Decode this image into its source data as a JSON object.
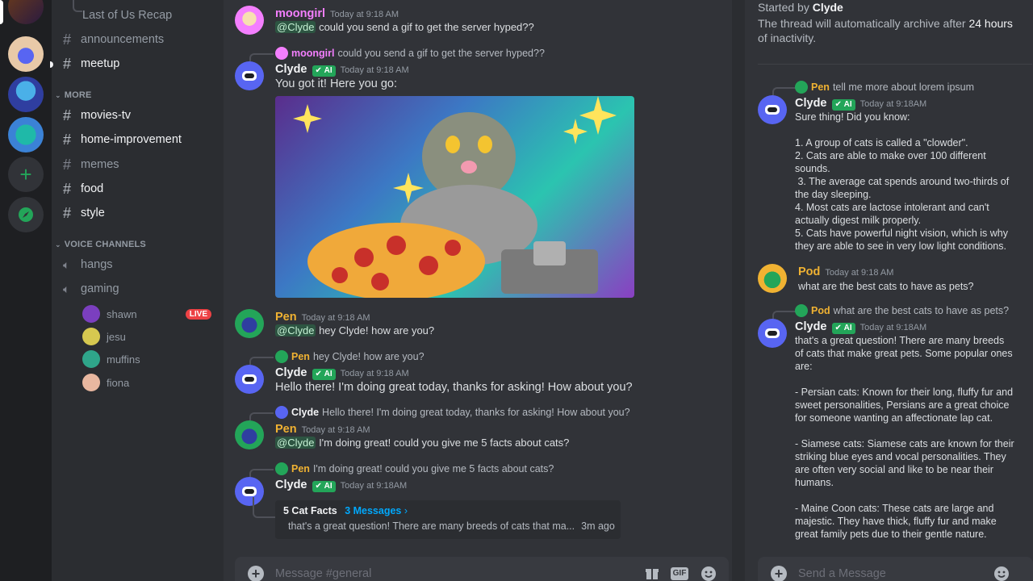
{
  "colors": {
    "accent_green": "#23a559",
    "pen_name": "#f0b232",
    "moongirl_name": "#f47fff",
    "clyde_name": "#f2f3f5",
    "link": "#00a8fc",
    "live": "#ed4245"
  },
  "rail": {
    "servers": [
      "server-icon-1",
      "server-icon-2",
      "server-icon-3",
      "server-icon-4"
    ],
    "add_server_icon": "plus-icon",
    "explore_icon": "compass-icon"
  },
  "sidebar": {
    "channels_top": [
      {
        "label": "Last of Us Recap"
      },
      {
        "label": "announcements"
      },
      {
        "label": "meetup"
      }
    ],
    "more_category": "MORE",
    "more_channels": [
      {
        "label": "movies-tv"
      },
      {
        "label": "home-improvement"
      },
      {
        "label": "memes"
      },
      {
        "label": "food"
      },
      {
        "label": "style"
      }
    ],
    "voice_category": "VOICE CHANNELS",
    "voice_channels": [
      {
        "label": "hangs"
      },
      {
        "label": "gaming"
      }
    ],
    "voice_users": [
      {
        "name": "shawn",
        "badge": "LIVE"
      },
      {
        "name": "jesu"
      },
      {
        "name": "muffins"
      },
      {
        "name": "fiona"
      }
    ]
  },
  "chat": {
    "messages": [
      {
        "user": "moongirl",
        "time": "Today at 9:18 AM",
        "mention": "@Clyde",
        "text": "could you send a gif to get the server hyped??"
      },
      {
        "reply_user": "moongirl",
        "reply_text": "could you send a gif to get the server hyped??",
        "user": "Clyde",
        "tag": "AI",
        "time": "Today at 9:18 AM",
        "text": "You got it! Here you go:"
      },
      {
        "user": "Pen",
        "time": "Today at 9:18 AM",
        "mention": "@Clyde",
        "text": "hey Clyde! how are you?"
      },
      {
        "reply_user": "Pen",
        "reply_text": "hey Clyde! how are you?",
        "user": "Clyde",
        "tag": "AI",
        "time": "Today at 9:18 AM",
        "text": "Hello there! I'm doing great today, thanks for asking! How about you?"
      },
      {
        "reply_user": "Clyde",
        "reply_text": "Hello there! I'm doing great today, thanks for asking! How about you?",
        "user": "Pen",
        "time": "Today at 9:18 AM",
        "mention": "@Clyde",
        "text": "I'm doing great! could you give me 5 facts about cats?"
      },
      {
        "reply_user": "Pen",
        "reply_text": "I'm doing great! could you give me 5 facts about cats?",
        "user": "Clyde",
        "tag": "AI",
        "time": "Today at 9:18AM"
      }
    ],
    "thread_card": {
      "title": "5 Cat Facts",
      "count": "3 Messages",
      "preview": "that's a great question! There are many breeds of cats that ma...",
      "age": "3m ago"
    },
    "composer_placeholder": "Message #general",
    "gif_label": "GIF"
  },
  "thread": {
    "started_label": "Started by",
    "started_user": "Clyde",
    "archive_text_1": "The thread will automatically archive after",
    "archive_bold": "24 hours",
    "archive_text_2": "of inactivity.",
    "messages": [
      {
        "reply_user": "Pen",
        "reply_text": "tell me more about lorem ipsum",
        "user": "Clyde",
        "tag": "AI",
        "time": "Today at 9:18AM",
        "text": "Sure thing! Did you know:\n\n1. A group of cats is called a \"clowder\".\n2. Cats are able to make over 100 different sounds.\n 3. The average cat spends around two-thirds of the day sleeping.\n4. Most cats are lactose intolerant and can't actually digest milk properly.\n5. Cats have powerful night vision, which is why they are able to see in very low light conditions."
      },
      {
        "user": "Pod",
        "time": "Today at 9:18 AM",
        "text": "what are the best cats to have as pets?"
      },
      {
        "reply_user": "Pod",
        "reply_text": "what are the best cats to have as pets?",
        "user": "Clyde",
        "tag": "AI",
        "time": "Today at 9:18AM",
        "text": "that's a great question! There are many breeds of cats that make great pets. Some popular ones are:\n\n- Persian cats: Known for their long, fluffy fur and sweet personalities, Persians are a great choice for someone wanting an affectionate lap cat.\n\n- Siamese cats: Siamese cats are known for their striking blue eyes and vocal personalities. They are often very social and like to be near their humans.\n\n- Maine Coon cats: These cats are large and majestic. They have thick, fluffy fur and make great family pets due to their gentle nature."
      }
    ],
    "composer_placeholder": "Send a Message"
  }
}
